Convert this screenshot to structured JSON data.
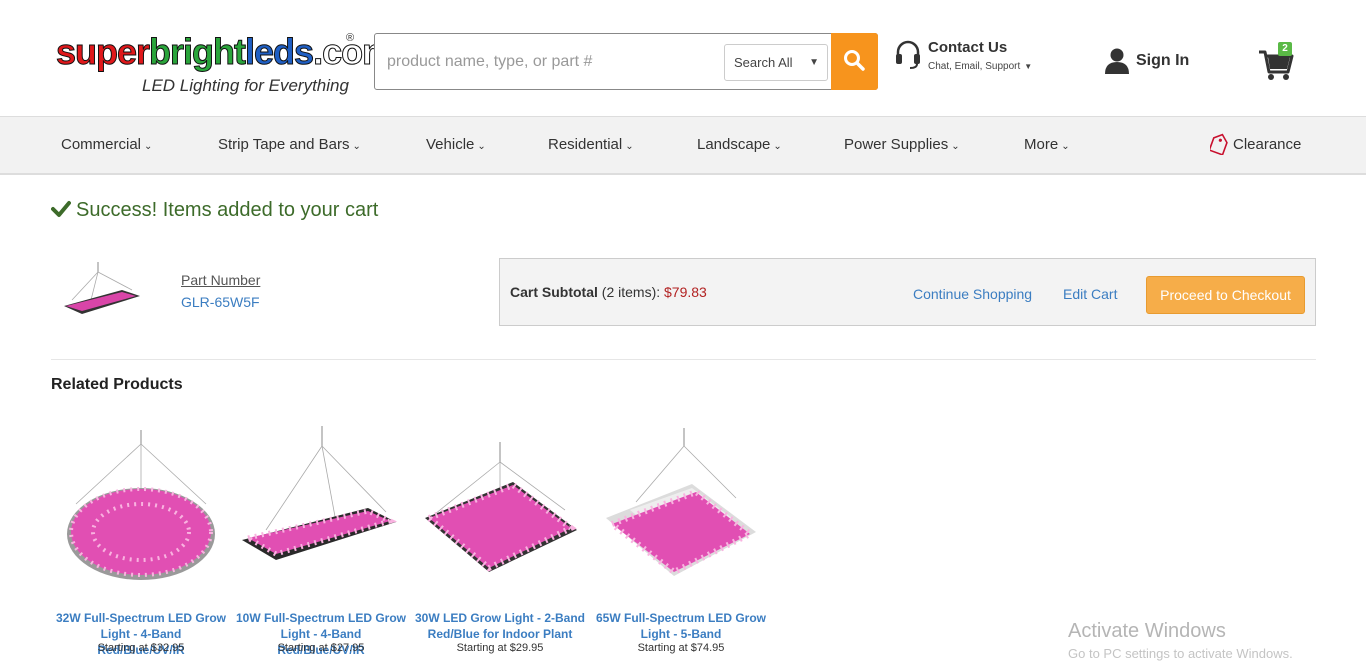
{
  "brand": {
    "logo_parts": [
      "super",
      "bright",
      "leds",
      ".com"
    ],
    "reg_mark": "®",
    "tagline": "LED Lighting for Everything"
  },
  "search": {
    "placeholder": "product name, type, or part #",
    "scope": "Search All",
    "accent_color": "#f7941d"
  },
  "contact": {
    "title": "Contact Us",
    "subtitle": "Chat, Email, Support"
  },
  "account": {
    "signin_label": "Sign In"
  },
  "cart": {
    "count": "2"
  },
  "nav": {
    "items": [
      {
        "label": "Commercial"
      },
      {
        "label": "Strip Tape and Bars"
      },
      {
        "label": "Vehicle"
      },
      {
        "label": "Residential"
      },
      {
        "label": "Landscape"
      },
      {
        "label": "Power Supplies"
      },
      {
        "label": "More"
      }
    ],
    "clearance": "Clearance"
  },
  "success_message": "Success! Items added to your cart",
  "added_item": {
    "part_label": "Part Number",
    "part_number": "GLR-65W5F"
  },
  "cart_summary": {
    "label": "Cart Subtotal",
    "items_text": "(2 items):",
    "price": "$79.83",
    "continue_label": "Continue Shopping",
    "edit_label": "Edit Cart",
    "checkout_label": "Proceed to Checkout"
  },
  "related": {
    "title": "Related Products",
    "products": [
      {
        "name": "32W Full-Spectrum LED Grow Light - 4-Band Red/Blue/UV/IR",
        "price": "Starting at $32.95"
      },
      {
        "name": "10W Full-Spectrum LED Grow Light - 4-Band Red/Blue/UV/IR",
        "price": "Starting at $27.95"
      },
      {
        "name": "30W LED Grow Light - 2-Band Red/Blue for Indoor Plant",
        "price": "Starting at $29.95"
      },
      {
        "name": "65W Full-Spectrum LED Grow Light - 5-Band",
        "price": "Starting at $74.95"
      }
    ]
  },
  "os_watermark": {
    "title": "Activate Windows",
    "subtitle": "Go to PC settings to activate Windows."
  }
}
